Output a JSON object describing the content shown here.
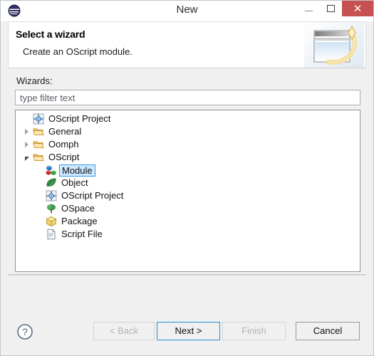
{
  "window": {
    "title": "New",
    "app_icon": "eclipse-icon",
    "controls": {
      "minimize": "minimize-icon",
      "maximize": "maximize-icon",
      "close": "close-icon",
      "close_glyph": "✕",
      "close_color": "#c75050"
    }
  },
  "header": {
    "title": "Select a wizard",
    "description": "Create an OScript module.",
    "banner_icon": "wizard-banner-icon"
  },
  "main": {
    "wizards_label": "Wizards:",
    "filter": {
      "value": "",
      "placeholder": "type filter text"
    },
    "tree": [
      {
        "label": "OScript Project",
        "icon": "oscript-project-icon",
        "indent": 0,
        "expander": "none",
        "selected": false
      },
      {
        "label": "General",
        "icon": "folder-icon",
        "indent": 0,
        "expander": "collapsed",
        "selected": false
      },
      {
        "label": "Oomph",
        "icon": "folder-icon",
        "indent": 0,
        "expander": "collapsed",
        "selected": false
      },
      {
        "label": "OScript",
        "icon": "folder-icon",
        "indent": 0,
        "expander": "expanded",
        "selected": false
      },
      {
        "label": "Module",
        "icon": "module-icon",
        "indent": 1,
        "expander": "none",
        "selected": true
      },
      {
        "label": "Object",
        "icon": "object-leaf-icon",
        "indent": 1,
        "expander": "none",
        "selected": false
      },
      {
        "label": "OScript Project",
        "icon": "oscript-project-icon",
        "indent": 1,
        "expander": "none",
        "selected": false
      },
      {
        "label": "OSpace",
        "icon": "ospace-tree-icon",
        "indent": 1,
        "expander": "none",
        "selected": false
      },
      {
        "label": "Package",
        "icon": "package-box-icon",
        "indent": 1,
        "expander": "none",
        "selected": false
      },
      {
        "label": "Script File",
        "icon": "script-file-icon",
        "indent": 1,
        "expander": "none",
        "selected": false
      }
    ]
  },
  "footer": {
    "help_icon": "help-icon",
    "buttons": {
      "back": {
        "label": "< Back",
        "state": "disabled"
      },
      "next": {
        "label": "Next >",
        "state": "default"
      },
      "finish": {
        "label": "Finish",
        "state": "disabled"
      },
      "cancel": {
        "label": "Cancel",
        "state": "enabled"
      }
    }
  },
  "colors": {
    "selection_fill": "#cde8ff",
    "selection_border": "#3b9ae1",
    "default_button_border": "#2a8fd8",
    "dialog_background": "#f0f0f0"
  }
}
